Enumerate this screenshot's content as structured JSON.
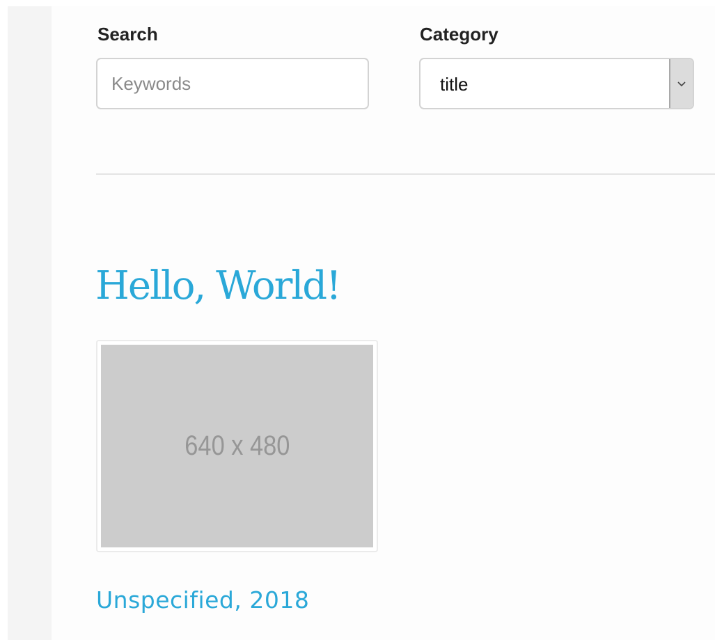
{
  "search": {
    "label": "Search",
    "placeholder": "Keywords",
    "value": ""
  },
  "category": {
    "label": "Category",
    "selected": "title",
    "arrow_icon": "chevron-down-icon"
  },
  "post": {
    "title": "Hello, World!",
    "thumbnail_text": "640 x 480",
    "meta": "Unspecified, 2018"
  },
  "colors": {
    "accent": "#2aa8d8",
    "placeholder_bg": "#cccccc",
    "placeholder_text": "#969696",
    "sidebar_bg": "#f4f4f4"
  }
}
